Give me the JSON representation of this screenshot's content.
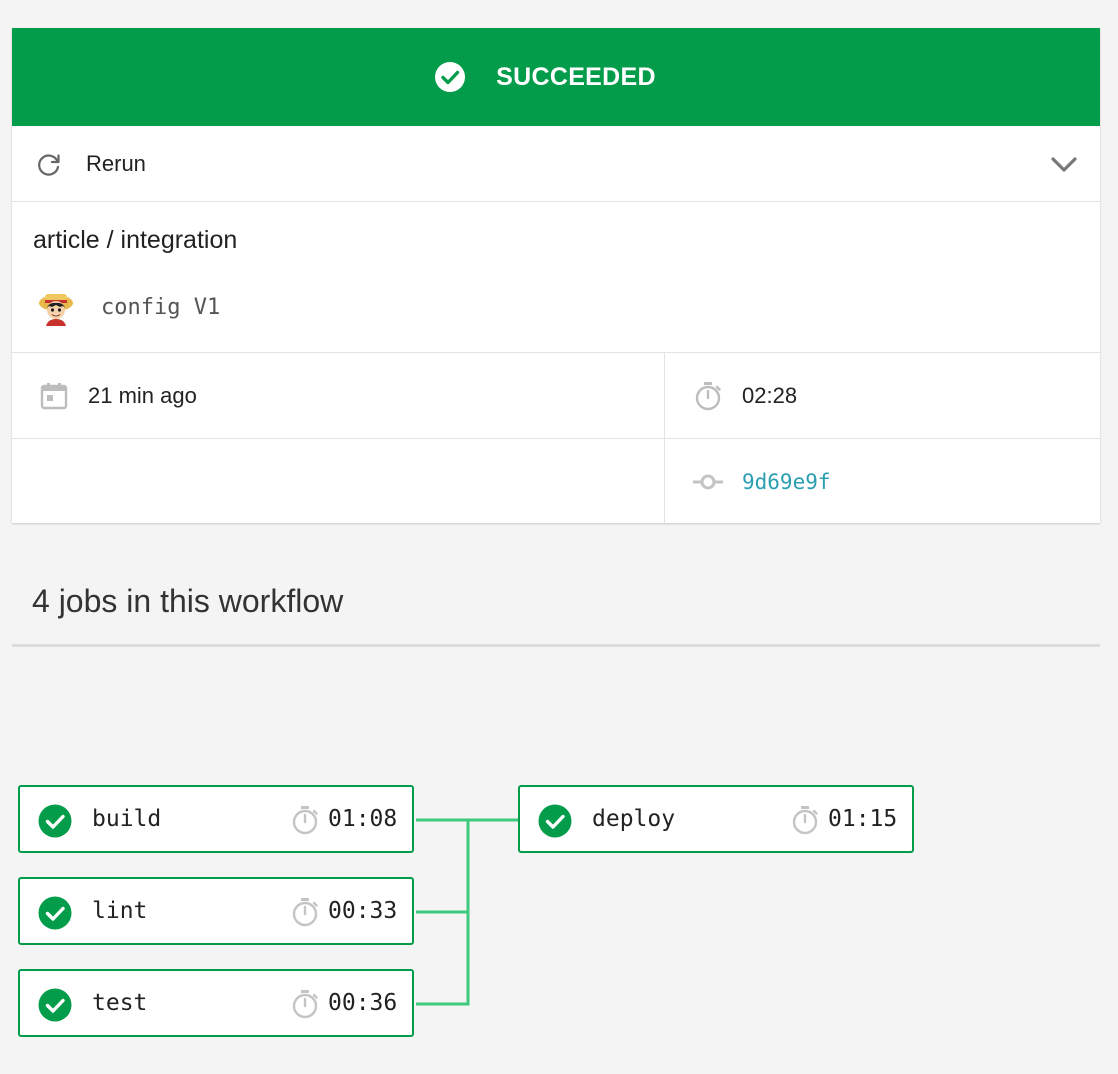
{
  "banner": {
    "status": "SUCCEEDED",
    "icon": "check-circle-icon",
    "color": "#039c4a"
  },
  "actions": {
    "rerun_label": "Rerun",
    "rerun_icon": "refresh-icon",
    "expand_icon": "chevron-down-icon"
  },
  "workflow": {
    "title": "article / integration",
    "config": "config V1",
    "started": "21 min ago",
    "duration": "02:28",
    "commit": "9d69e9f"
  },
  "jobs_section": {
    "title": "4 jobs in this workflow"
  },
  "jobs": [
    {
      "name": "build",
      "duration": "01:08",
      "status": "success"
    },
    {
      "name": "lint",
      "duration": "00:33",
      "status": "success"
    },
    {
      "name": "test",
      "duration": "00:36",
      "status": "success"
    },
    {
      "name": "deploy",
      "duration": "01:15",
      "status": "success"
    }
  ],
  "colors": {
    "success": "#039c4a",
    "connector": "#3ec97e",
    "link": "#2a9fb2"
  }
}
